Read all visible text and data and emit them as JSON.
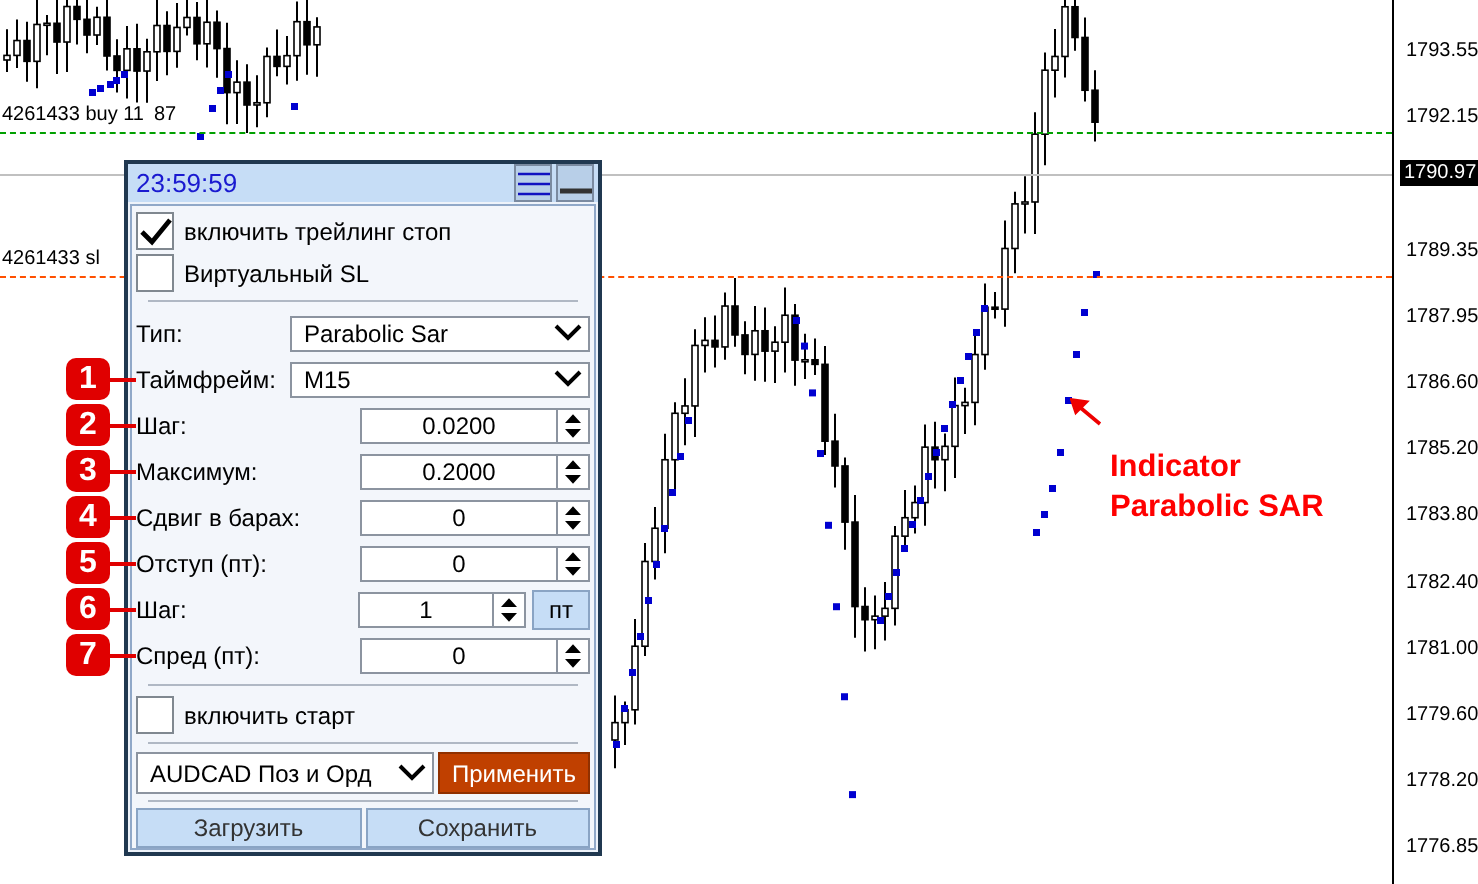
{
  "chart": {
    "price_axis": [
      "1793.55",
      "1792.15",
      "1789.35",
      "1787.95",
      "1786.60",
      "1785.20",
      "1783.80",
      "1782.40",
      "1781.00",
      "1779.60",
      "1778.20",
      "1776.85"
    ],
    "current_price": "1790.97",
    "order_lines": [
      {
        "kind": "buy",
        "label": "4261433 buy 11",
        "label_tail": "87"
      },
      {
        "kind": "sl",
        "label": "4261433 sl"
      }
    ],
    "annotation": "Indicator Parabolic SAR"
  },
  "panel": {
    "clock": "23:59:59",
    "checkboxes": [
      {
        "label": "включить трейлинг стоп",
        "checked": true
      },
      {
        "label": "Виртуальный SL",
        "checked": false
      }
    ],
    "fields": [
      {
        "kind": "select",
        "label": "Тип:",
        "value": "Parabolic Sar"
      },
      {
        "kind": "select",
        "label": "Таймфрейм:",
        "value": "M15",
        "badge": "1"
      },
      {
        "kind": "spinner",
        "label": "Шаг:",
        "value": "0.0200",
        "badge": "2"
      },
      {
        "kind": "spinner",
        "label": "Максимум:",
        "value": "0.2000",
        "badge": "3"
      },
      {
        "kind": "spinner",
        "label": "Сдвиг в барах:",
        "value": "0",
        "badge": "4"
      },
      {
        "kind": "spinner",
        "label": "Отступ (пт):",
        "value": "0",
        "badge": "5"
      },
      {
        "kind": "spinner_unit",
        "label": "Шаг:",
        "value": "1",
        "unit": "пт",
        "badge": "6"
      },
      {
        "kind": "spinner",
        "label": "Спред (пт):",
        "value": "0",
        "badge": "7"
      }
    ],
    "start_checkbox": {
      "label": "включить старт",
      "checked": false
    },
    "preset": "AUDCAD Поз и Орд",
    "apply": "Применить",
    "buttons": [
      "Загрузить",
      "Сохранить"
    ]
  }
}
